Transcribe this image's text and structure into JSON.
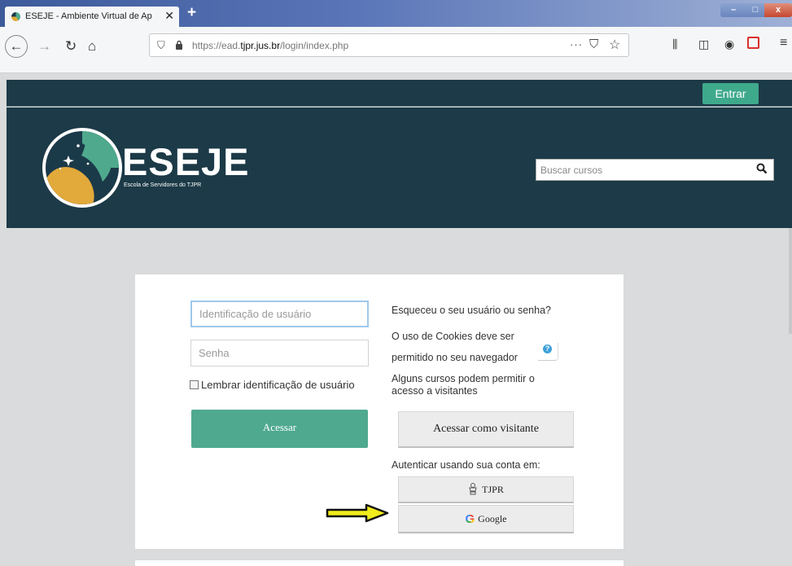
{
  "browser": {
    "tab_title": "ESEJE - Ambiente Virtual de Ap",
    "tab_close": "✕",
    "new_tab": "+",
    "url_prefix": "https://ead.",
    "url_domain": "tjpr.jus.br",
    "url_path": "/login/index.php",
    "page_actions": "···",
    "icons": [
      "back-icon",
      "forward-icon",
      "reload-icon",
      "home-icon",
      "shield-icon",
      "lock-icon",
      "pocket-icon",
      "bookmark-star-icon",
      "library-icon",
      "sidebar-icon",
      "account-icon",
      "pdf-icon",
      "menu-icon"
    ]
  },
  "site": {
    "login_button": "Entrar",
    "brand": "ESEJE",
    "brand_subtitle": "Escola de Servidores do TJPR",
    "search_placeholder": "Buscar cursos",
    "colors": {
      "navy": "#1c3a47",
      "teal": "#3fa98c",
      "gold": "#e2a93b"
    }
  },
  "login": {
    "username_placeholder": "Identificação de usuário",
    "password_placeholder": "Senha",
    "remember_label": "Lembrar identificação de usuário",
    "submit_label": "Acessar",
    "forgot_text": "Esqueceu o seu usuário ou senha?",
    "cookies_text": "O uso de Cookies deve ser permitido no seu navegador",
    "guests_text": "Alguns cursos podem permitir o acesso a visitantes",
    "guest_button": "Acessar como visitante",
    "auth_label": "Autenticar usando sua conta em:",
    "tjpr_button": "TJPR",
    "google_button": "Google"
  }
}
